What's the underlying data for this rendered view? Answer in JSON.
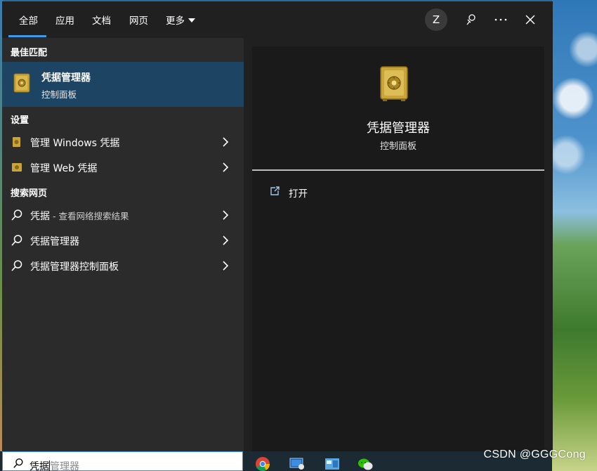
{
  "tabs": [
    "全部",
    "应用",
    "文档",
    "网页",
    "更多"
  ],
  "avatar_letter": "Z",
  "best_match": {
    "section": "最佳匹配",
    "title": "凭据管理器",
    "subtitle": "控制面板"
  },
  "settings": {
    "section": "设置",
    "items": [
      "管理 Windows 凭据",
      "管理 Web 凭据"
    ]
  },
  "web": {
    "section": "搜索网页",
    "items": [
      {
        "term": "凭据",
        "suffix": " - 查看网络搜索结果"
      },
      {
        "term": "凭据管理器",
        "suffix": ""
      },
      {
        "term": "凭据管理器控制面板",
        "suffix": ""
      }
    ]
  },
  "detail": {
    "title": "凭据管理器",
    "subtitle": "控制面板",
    "actions": [
      "打开"
    ]
  },
  "search": {
    "typed": "凭据",
    "suggestion": "管理器"
  },
  "watermark": "CSDN @GGGCong",
  "icons": [
    "search-icon",
    "feedback-icon",
    "more-icon",
    "close-icon",
    "chevron-right-icon",
    "open-icon",
    "safe-icon",
    "chrome-icon",
    "remote-desktop-icon",
    "control-panel-icon",
    "wechat-icon"
  ],
  "colors": {
    "accent": "#3d9ae8",
    "selected": "#1e4464",
    "panel": "#202020"
  }
}
